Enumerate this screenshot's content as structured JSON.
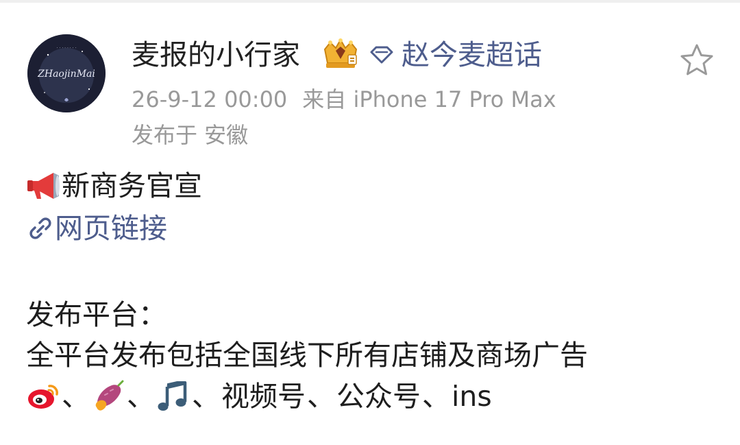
{
  "post": {
    "username": "麦报的小行家",
    "topic": "赵今麦超话",
    "timestamp": "26-9-12 00:00",
    "source": "来自 iPhone 17 Pro Max",
    "location": "发布于 安徽",
    "avatar_text": "ZHaojinMai"
  },
  "content": {
    "announce": "新商务官宣",
    "link_label": "网页链接",
    "platform_heading": "发布平台：",
    "platform_desc": "全平台发布包括全国线下所有店铺及商场广告",
    "sep": "、",
    "platform_video": "视频号",
    "platform_public": "公众号",
    "platform_ins": "ins"
  },
  "icons": {
    "vip": "crown-badge-icon",
    "topic": "diamond-topic-icon",
    "favorite": "star-icon",
    "announce": "megaphone-icon",
    "link": "link-icon",
    "weibo": "weibo-icon",
    "xiaohongshu": "sweet-potato-icon",
    "douyin": "music-note-icon"
  },
  "colors": {
    "link": "#4e5d8d",
    "meta": "#999999",
    "text": "#1e1e1e"
  }
}
